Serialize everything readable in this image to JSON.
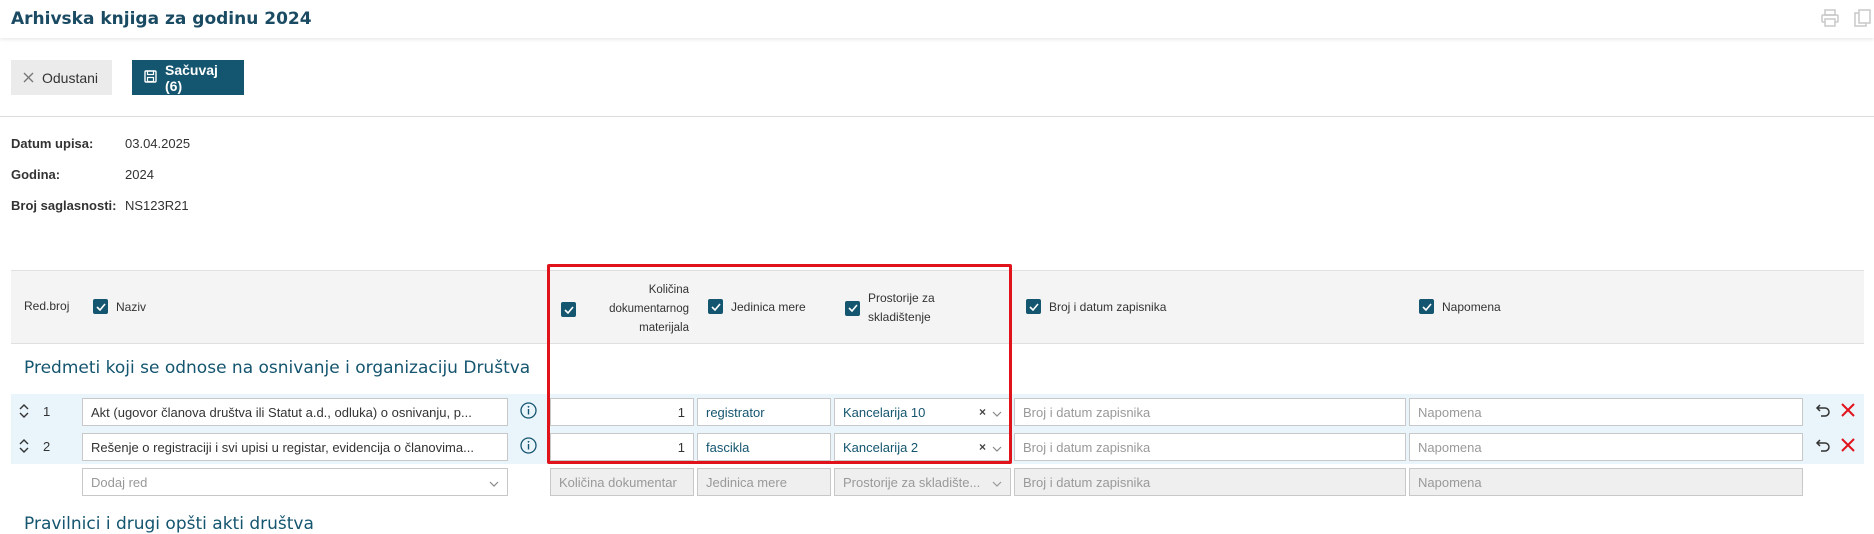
{
  "header": {
    "title": "Arhivska knjiga za godinu 2024",
    "icons": [
      "print-icon",
      "copy-icon"
    ]
  },
  "toolbar": {
    "cancel_label": "Odustani",
    "save_label": "Sačuvaj (6)"
  },
  "info": [
    {
      "label": "Datum upisa:",
      "value": "03.04.2025"
    },
    {
      "label": "Godina:",
      "value": "2024"
    },
    {
      "label": "Broj saglasnosti:",
      "value": "NS123R21"
    }
  ],
  "columns": {
    "red_broj": "Red.broj",
    "naziv": "Naziv",
    "kolicina": "Količina dokumentarnog materijala",
    "jedinica": "Jedinica mere",
    "prostorije": "Prostorije za skladištenje",
    "broj_datum": "Broj i datum zapisnika",
    "napomena": "Napomena"
  },
  "sections": [
    {
      "title": "Predmeti koji se odnose na osnivanje i organizaciju Društva",
      "rows": [
        {
          "num": "1",
          "naziv": "Akt (ugovor članova društva ili Statut a.d., odluka) o osnivanju, p...",
          "kolicina": "1",
          "jedinica": "registrator",
          "prostorija": "Kancelarija 10",
          "broj_placeholder": "Broj i datum zapisnika",
          "napomena_placeholder": "Napomena"
        },
        {
          "num": "2",
          "naziv": "Rešenje o registraciji i svi upisi u registar, evidencija o članovima...",
          "kolicina": "1",
          "jedinica": "fascikla",
          "prostorija": "Kancelarija 2",
          "broj_placeholder": "Broj i datum zapisnika",
          "napomena_placeholder": "Napomena"
        }
      ],
      "add_row": {
        "naziv_placeholder": "Dodaj red",
        "kolicina_placeholder": "Količina dokumentar",
        "jedinica_placeholder": "Jedinica mere",
        "prostorije_placeholder": "Prostorije za skladište...",
        "broj_placeholder": "Broj i datum zapisnika",
        "napomena_placeholder": "Napomena"
      }
    },
    {
      "title": "Pravilnici i drugi opšti akti društva"
    }
  ],
  "colors": {
    "accent": "#14556f",
    "title": "#1a4b63",
    "highlight": "#e0131b",
    "row_band": "#eaf4fb",
    "delete": "#e0131b"
  }
}
